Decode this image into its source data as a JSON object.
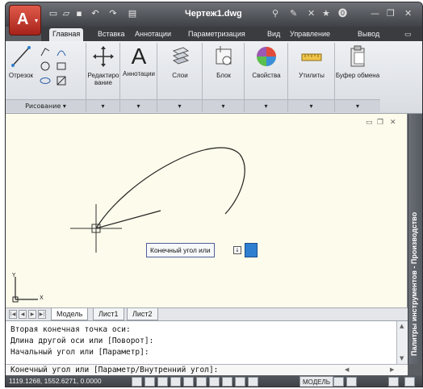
{
  "window": {
    "title": "Чертеж1.dwg"
  },
  "tabs": [
    {
      "label": "Главная",
      "active": true
    },
    {
      "label": "Вставка",
      "active": false
    },
    {
      "label": "Аннотации",
      "active": false
    },
    {
      "label": "Параметризация",
      "active": false
    },
    {
      "label": "Вид",
      "active": false
    },
    {
      "label": "Управление",
      "active": false
    },
    {
      "label": "Вывод",
      "active": false
    }
  ],
  "ribbon": {
    "draw_panel": {
      "line_label": "Отрезок",
      "footer": "Рисование ▾"
    },
    "tools": {
      "edit": "Редактиро вание",
      "annotation": "Аннотации",
      "layers": "Слои",
      "block": "Блок",
      "properties": "Свойства",
      "utilities": "Утилиты",
      "clipboard": "Буфер обмена"
    }
  },
  "drawing": {
    "dynamic_prompt": "Конечный угол или",
    "ucs": {
      "x": "X",
      "y": "Y"
    }
  },
  "tool_palette": {
    "label": "Палитры инструментов - Производство"
  },
  "layout_tabs": [
    {
      "label": "Модель",
      "active": true
    },
    {
      "label": "Лист1",
      "active": false
    },
    {
      "label": "Лист2",
      "active": false
    }
  ],
  "command_history": [
    "Вторая конечная точка оси:",
    "Длина другой оси или [Поворот]:",
    "Начальный угол или [Параметр]:"
  ],
  "command_prompt": "Конечный угол или [Параметр/Внутренний угол]:",
  "status_bar": {
    "coordinates": "1119.1268, 1552.6271, 0.0000",
    "model_label": "МОДЕЛЬ"
  },
  "colors": {
    "accent": "#2f7fd0",
    "drawing_bg": "#fdfbeb",
    "app_button": "#c0392b"
  }
}
